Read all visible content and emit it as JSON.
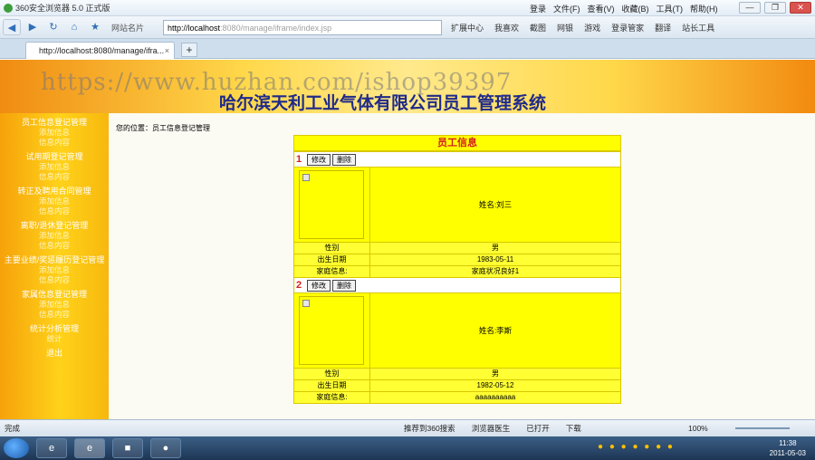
{
  "browser": {
    "title": "360安全浏览器 5.0 正式版",
    "menus": [
      "登录",
      "文件(F)",
      "查看(V)",
      "收藏(B)",
      "工具(T)",
      "帮助(H)"
    ],
    "window_buttons": [
      "—",
      "❐",
      "✕"
    ],
    "fav_label": "网站名片",
    "url_host": "http://localhost",
    "url_path": ":8080/manage/iframe/index.jsp",
    "tools": [
      "扩展中心",
      "我喜欢",
      "截图",
      "网银",
      "游戏",
      "登录管家",
      "翻译",
      "站长工具"
    ],
    "tab_label": "http://localhost:8080/manage/ifra...",
    "tab_close": "×",
    "new_tab": "+"
  },
  "banner": {
    "watermark": "https://www.huzhan.com/ishop39397",
    "system_name": "哈尔滨天利工业气体有限公司员工管理系统"
  },
  "sidebar": {
    "groups": [
      {
        "title": "员工信息登记管理",
        "subs": [
          "添加信息",
          "信息内容"
        ]
      },
      {
        "title": "试用期登记管理",
        "subs": [
          "添加信息",
          "信息内容"
        ]
      },
      {
        "title": "转正及聘用合同管理",
        "subs": [
          "添加信息",
          "信息内容"
        ]
      },
      {
        "title": "离职/退休登记管理",
        "subs": [
          "添加信息",
          "信息内容"
        ]
      },
      {
        "title": "主要业绩/奖惩履历登记管理",
        "subs": [
          "添加信息",
          "信息内容"
        ]
      },
      {
        "title": "家属信息登记管理",
        "subs": [
          "添加信息",
          "信息内容"
        ]
      },
      {
        "title": "统计分析管理",
        "subs": [
          "统计"
        ]
      },
      {
        "title": "退出",
        "subs": []
      }
    ]
  },
  "content": {
    "location": "您的位置：员工信息登记管理",
    "panel_title": "员工信息",
    "edit_label": "修改",
    "delete_label": "删除",
    "records": [
      {
        "num": "1",
        "name": "姓名:刘三",
        "gender_label": "性别",
        "gender": "男",
        "birth_label": "出生日期",
        "birth": "1983-05-11",
        "family_label": "家庭信息:",
        "family": "家庭状况良好1"
      },
      {
        "num": "2",
        "name": "姓名:李斯",
        "gender_label": "性别",
        "gender": "男",
        "birth_label": "出生日期",
        "birth": "1982-05-12",
        "family_label": "家庭信息:",
        "family": "aaaaaaaaaa"
      }
    ]
  },
  "statusbar": {
    "done": "完成",
    "items": [
      "推荐到360搜索",
      "浏览器医生",
      "已打开",
      "下载"
    ],
    "zoom": "100%"
  },
  "taskbar": {
    "tasks": [
      "e",
      "e",
      "■",
      "●"
    ],
    "time": "11:38",
    "date": "2011-05-03"
  }
}
